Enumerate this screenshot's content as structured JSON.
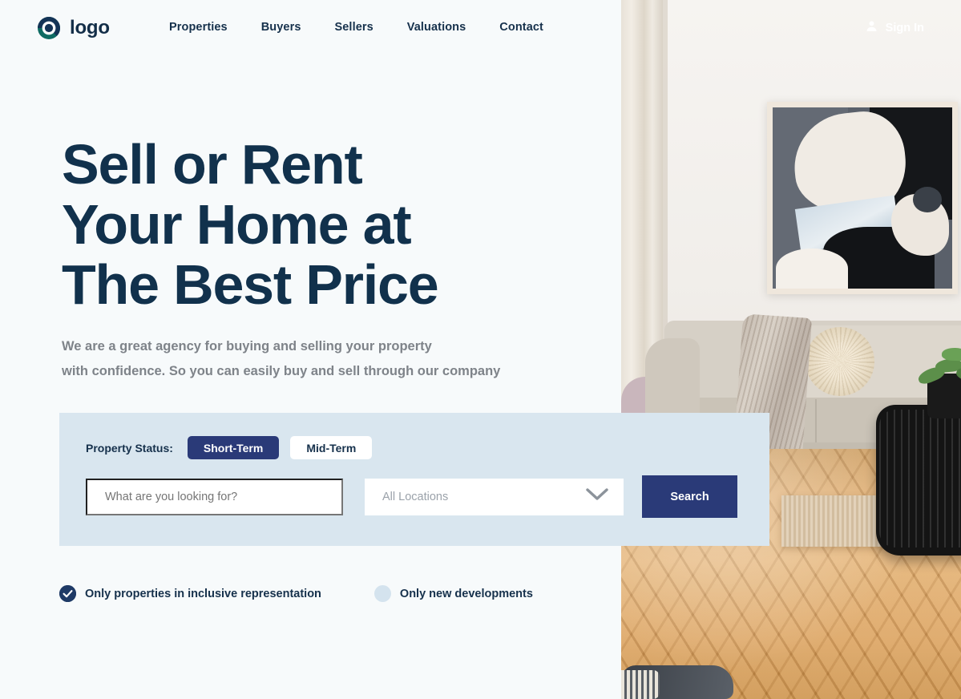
{
  "brand": {
    "name": "logo",
    "logo_icon": "circle-target-logo-icon",
    "navy": "#132E48",
    "teal": "#0E6B63"
  },
  "nav": {
    "items": [
      {
        "label": "Properties"
      },
      {
        "label": "Buyers"
      },
      {
        "label": "Sellers"
      },
      {
        "label": "Valuations"
      },
      {
        "label": "Contact"
      }
    ]
  },
  "account": {
    "signin_label": "Sign In",
    "icon": "user-icon"
  },
  "hero": {
    "title_line1": "Sell or Rent",
    "title_line2": "Your Home at",
    "title_line3": "The Best Price",
    "subtitle_line1": "We are a great agency for buying and selling your property",
    "subtitle_line2": "with confidence. So you can easily buy and sell through our company",
    "title_color": "#11314C",
    "subtitle_color": "#7E8389"
  },
  "search_panel": {
    "background": "#D9E6EF",
    "status_label": "Property Status:",
    "status_options": [
      {
        "label": "Short-Term",
        "selected": true
      },
      {
        "label": "Mid-Term",
        "selected": false
      }
    ],
    "query_placeholder": "What are you looking for?",
    "query_value": "",
    "location_value": "All Locations",
    "location_icon": "chevron-down-icon",
    "search_button_label": "Search",
    "accent": "#2A3A78"
  },
  "filters": [
    {
      "label": "Only properties in inclusive representation",
      "checked": true,
      "icon": "check-icon"
    },
    {
      "label": "Only new developments",
      "checked": false,
      "icon": "empty-circle-icon"
    }
  ],
  "photo": {
    "alt": "living-room-interior-photo"
  }
}
